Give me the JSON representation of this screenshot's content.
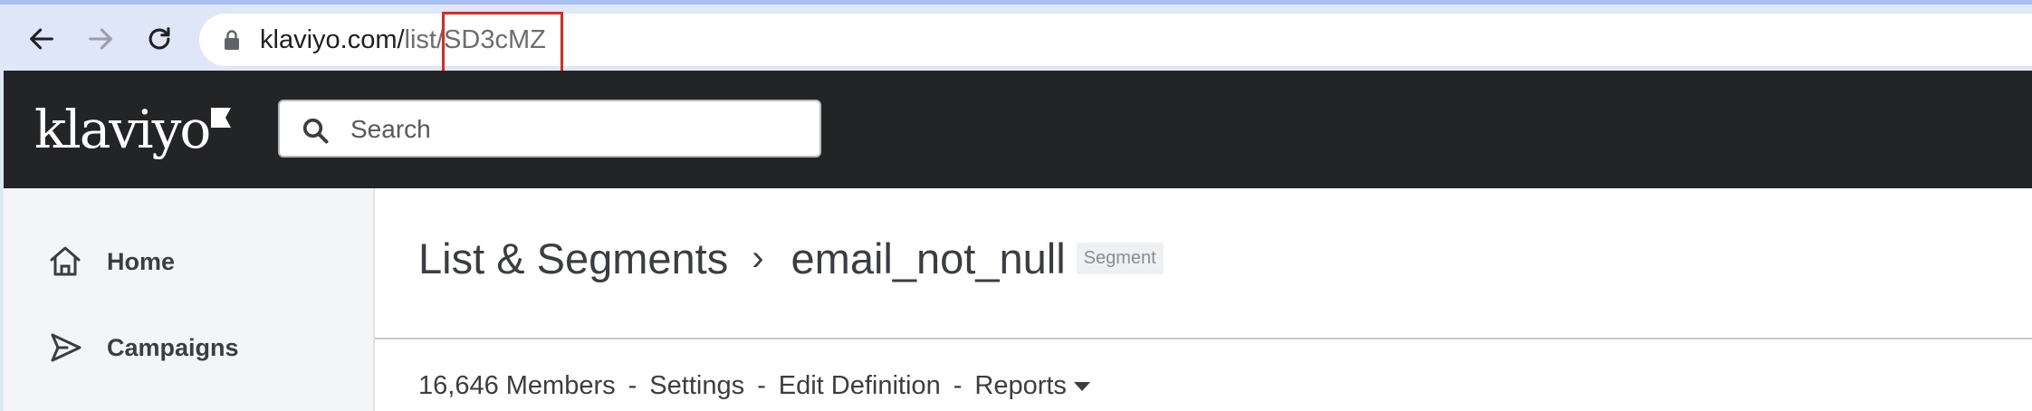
{
  "browser": {
    "url_host": "klaviyo.com/",
    "url_path_1": "list",
    "url_path_2": "/SD3cMZ"
  },
  "header": {
    "logo_text": "klaviyo",
    "search_placeholder": "Search"
  },
  "sidebar": {
    "items": [
      {
        "label": "Home",
        "icon": "home-icon"
      },
      {
        "label": "Campaigns",
        "icon": "campaigns-icon"
      }
    ]
  },
  "main": {
    "breadcrumb_parent": "List & Segments",
    "breadcrumb_separator": "›",
    "title": "email_not_null",
    "badge": "Segment",
    "members": "16,646 Members",
    "separator": "-",
    "settings": "Settings",
    "edit_definition": "Edit Definition",
    "reports": "Reports"
  },
  "colors": {
    "header_bg": "#232426",
    "highlight": "#e0281c",
    "sidebar_bg": "#f4f5f6"
  }
}
